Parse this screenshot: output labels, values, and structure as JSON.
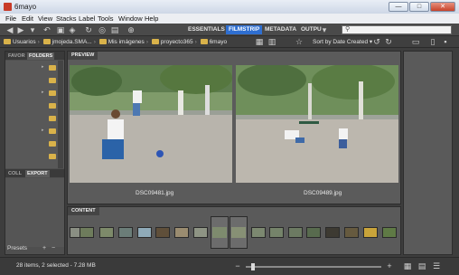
{
  "window": {
    "title": "6mayo",
    "min_label": "—",
    "max_label": "□",
    "close_label": "✕"
  },
  "menu": [
    "File",
    "Edit",
    "View",
    "Stacks",
    "Label",
    "Tools",
    "Window",
    "Help"
  ],
  "toolbar": {
    "workspaces": [
      "ESSENTIALS",
      "FILMSTRIP",
      "METADATA",
      "OUTPU"
    ],
    "active_workspace": "FILMSTRIP",
    "sort_label": "Sort by Date Created",
    "search_placeholder": ""
  },
  "breadcrumb": [
    "Usuarios",
    "jmojeda.SMA...",
    "Mis imágenes",
    "proyecto365",
    "6mayo"
  ],
  "left_panel": {
    "tabs_top": [
      "FAVOR",
      "FOLDERS"
    ],
    "tabs_bottom": [
      "COLL",
      "EXPORT"
    ],
    "presets_label": "Presets"
  },
  "preview": {
    "title": "PREVIEW",
    "captions": [
      "DSC09481.jpg",
      "DSC09489.jpg"
    ]
  },
  "content": {
    "title": "CONTENT"
  },
  "status": {
    "text": "28 items, 2 selected - 7.28 MB"
  },
  "colors": {
    "accent": "#2f6fd1",
    "folder": "#d9b24a",
    "panel": "#5a5a5a"
  }
}
